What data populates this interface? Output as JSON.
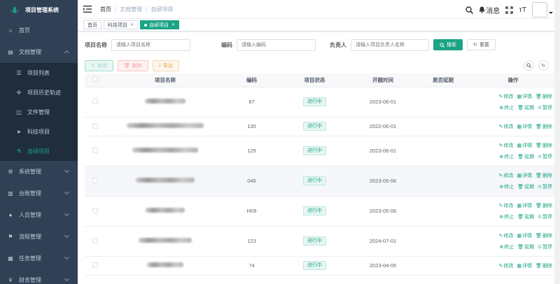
{
  "app": {
    "title": "项目管理系统"
  },
  "sidebar": {
    "items": [
      {
        "label": "首页",
        "icon": "dashboard-icon",
        "glyph": "⌂",
        "expandable": false
      },
      {
        "label": "文档管理",
        "icon": "document-icon",
        "glyph": "▤",
        "expandable": true,
        "expanded": true,
        "children": [
          {
            "label": "项目列表",
            "icon": "list-icon",
            "glyph": "☰",
            "active": false
          },
          {
            "label": "项目历史轨迹",
            "icon": "track-icon",
            "glyph": "✣",
            "active": false
          },
          {
            "label": "文件管理",
            "icon": "file-icon",
            "glyph": "◫",
            "active": false
          },
          {
            "label": "科技项目",
            "icon": "send-icon",
            "glyph": "➤",
            "active": false
          },
          {
            "label": "自研项目",
            "icon": "research-icon",
            "glyph": "⚗",
            "active": true
          }
        ]
      },
      {
        "label": "系统管理",
        "icon": "gear-icon",
        "glyph": "⚙",
        "expandable": true
      },
      {
        "label": "台账管理",
        "icon": "ledger-icon",
        "glyph": "▥",
        "expandable": true
      },
      {
        "label": "人员管理",
        "icon": "user-icon",
        "glyph": "●",
        "expandable": true
      },
      {
        "label": "流程管理",
        "icon": "flow-icon",
        "glyph": "⚑",
        "expandable": true
      },
      {
        "label": "任务管理",
        "icon": "task-icon",
        "glyph": "▦",
        "expandable": true
      },
      {
        "label": "财务管理",
        "icon": "finance-icon",
        "glyph": "¥",
        "expandable": true
      }
    ]
  },
  "navbar": {
    "breadcrumb": [
      "首页",
      "文档管理",
      "自研项目"
    ],
    "message_label": "消息",
    "font_size_label": "тT"
  },
  "tags": [
    {
      "label": "首页",
      "active": false,
      "closable": false
    },
    {
      "label": "科技项目",
      "active": false,
      "closable": true
    },
    {
      "label": "自研项目",
      "active": true,
      "closable": true
    }
  ],
  "search": {
    "name_label": "项目名称",
    "name_placeholder": "请输入项目名称",
    "code_label": "编码",
    "code_placeholder": "请输入编码",
    "owner_label": "负责人",
    "owner_placeholder": "请输入项目负责人名称",
    "search_button": "搜索",
    "reset_button": "重置"
  },
  "toolbar": {
    "edit": "修改",
    "delete": "删除",
    "export": "导出"
  },
  "table": {
    "headers": [
      "项目名称",
      "编码",
      "项目状态",
      "开题时间",
      "是否延期",
      "操作"
    ],
    "rows": [
      {
        "code": "67",
        "status": "进行中",
        "start": "2023-06-01",
        "delayed": "",
        "name_w": 58,
        "ops2": true,
        "hover": false
      },
      {
        "code": "130",
        "status": "进行中",
        "start": "2022-06-01",
        "delayed": "",
        "name_w": 110,
        "ops2": false,
        "hover": false
      },
      {
        "code": "129",
        "status": "进行中",
        "start": "2023-06-01",
        "delayed": "",
        "name_w": 94,
        "ops2": true,
        "hover": false
      },
      {
        "code": "045",
        "status": "进行中",
        "start": "2023-05-06",
        "delayed": "",
        "name_w": 84,
        "ops2": true,
        "hover": true
      },
      {
        "code": "H09",
        "status": "进行中",
        "start": "2023-05-06",
        "delayed": "",
        "name_w": 56,
        "ops2": true,
        "hover": false
      },
      {
        "code": "123",
        "status": "进行中",
        "start": "2024-07-01",
        "delayed": "",
        "name_w": 76,
        "ops2": true,
        "hover": false
      },
      {
        "code": "74",
        "status": "进行中",
        "start": "2023-04-05",
        "delayed": "",
        "name_w": 52,
        "ops2": false,
        "hover": false
      }
    ],
    "ops_row1": [
      "修改",
      "详情",
      "删除"
    ],
    "ops_row2": [
      "终止",
      "延期",
      "暂停"
    ]
  },
  "colors": {
    "sidebar_bg": "#304156",
    "accent": "#1aa385"
  }
}
